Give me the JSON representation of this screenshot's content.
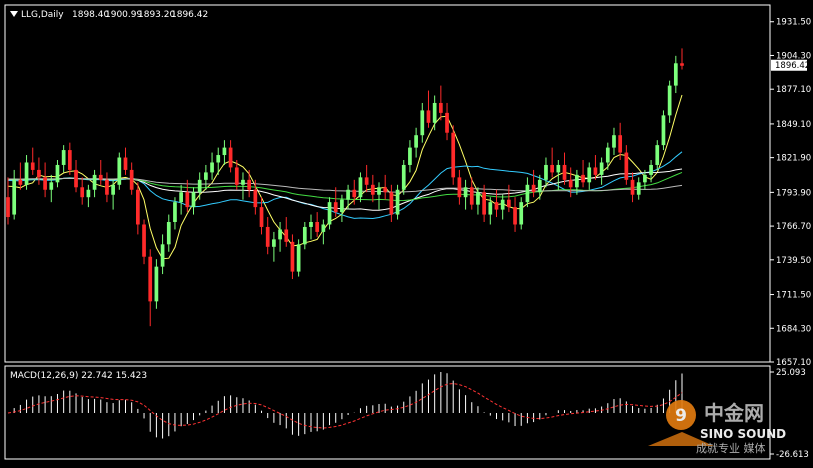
{
  "chart_data": [
    {
      "type": "candlestick",
      "symbol_label": "LLG,Daily",
      "ohlc_readout": [
        "1898.40",
        "1900.99",
        "1893.20",
        "1896.42"
      ],
      "ylim": [
        1657.1,
        1945
      ],
      "y_ticks": [
        "1931.50",
        "1904.30",
        "1877.10",
        "1849.10",
        "1821.90",
        "1793.90",
        "1766.70",
        "1739.50",
        "1711.50",
        "1684.30",
        "1657.10"
      ],
      "last_price": "1896.42",
      "colors": {
        "up": "#7CFF7C",
        "down": "#FF2A2A",
        "background": "#000000",
        "axis": "#FFFFFF"
      },
      "moving_averages": [
        {
          "color": "#FFFF66"
        },
        {
          "color": "#33CCFF"
        },
        {
          "color": "#FFFFFF"
        },
        {
          "color": "#44DD44"
        },
        {
          "color": "#BBBBBB"
        }
      ],
      "ohlc_estimated": [
        [
          1790,
          1806,
          1768,
          1774
        ],
        [
          1776,
          1812,
          1772,
          1804
        ],
        [
          1804,
          1818,
          1796,
          1800
        ],
        [
          1800,
          1824,
          1796,
          1818
        ],
        [
          1818,
          1830,
          1808,
          1812
        ],
        [
          1812,
          1822,
          1800,
          1806
        ],
        [
          1806,
          1818,
          1790,
          1796
        ],
        [
          1796,
          1808,
          1786,
          1802
        ],
        [
          1802,
          1820,
          1798,
          1816
        ],
        [
          1816,
          1832,
          1810,
          1828
        ],
        [
          1828,
          1834,
          1808,
          1812
        ],
        [
          1812,
          1820,
          1794,
          1798
        ],
        [
          1798,
          1806,
          1784,
          1790
        ],
        [
          1790,
          1800,
          1782,
          1796
        ],
        [
          1796,
          1812,
          1790,
          1808
        ],
        [
          1808,
          1820,
          1800,
          1804
        ],
        [
          1804,
          1810,
          1786,
          1792
        ],
        [
          1792,
          1804,
          1780,
          1800
        ],
        [
          1800,
          1826,
          1796,
          1822
        ],
        [
          1822,
          1830,
          1808,
          1812
        ],
        [
          1812,
          1818,
          1792,
          1796
        ],
        [
          1796,
          1802,
          1760,
          1768
        ],
        [
          1768,
          1772,
          1736,
          1742
        ],
        [
          1742,
          1748,
          1686,
          1706
        ],
        [
          1706,
          1740,
          1700,
          1734
        ],
        [
          1734,
          1760,
          1728,
          1752
        ],
        [
          1752,
          1776,
          1746,
          1770
        ],
        [
          1770,
          1790,
          1764,
          1786
        ],
        [
          1786,
          1800,
          1776,
          1794
        ],
        [
          1794,
          1804,
          1778,
          1782
        ],
        [
          1782,
          1798,
          1776,
          1794
        ],
        [
          1794,
          1810,
          1788,
          1804
        ],
        [
          1804,
          1816,
          1796,
          1810
        ],
        [
          1810,
          1826,
          1804,
          1818
        ],
        [
          1818,
          1830,
          1808,
          1824
        ],
        [
          1824,
          1836,
          1816,
          1830
        ],
        [
          1830,
          1836,
          1810,
          1814
        ],
        [
          1814,
          1820,
          1796,
          1800
        ],
        [
          1800,
          1810,
          1788,
          1804
        ],
        [
          1804,
          1812,
          1790,
          1796
        ],
        [
          1796,
          1804,
          1776,
          1782
        ],
        [
          1782,
          1790,
          1760,
          1766
        ],
        [
          1766,
          1774,
          1744,
          1750
        ],
        [
          1750,
          1762,
          1738,
          1756
        ],
        [
          1756,
          1770,
          1746,
          1764
        ],
        [
          1764,
          1774,
          1750,
          1754
        ],
        [
          1754,
          1760,
          1724,
          1730
        ],
        [
          1730,
          1756,
          1726,
          1752
        ],
        [
          1752,
          1770,
          1748,
          1766
        ],
        [
          1766,
          1776,
          1756,
          1770
        ],
        [
          1770,
          1778,
          1758,
          1762
        ],
        [
          1762,
          1772,
          1752,
          1768
        ],
        [
          1768,
          1790,
          1764,
          1786
        ],
        [
          1786,
          1798,
          1774,
          1778
        ],
        [
          1778,
          1792,
          1770,
          1788
        ],
        [
          1788,
          1800,
          1780,
          1796
        ],
        [
          1796,
          1804,
          1784,
          1790
        ],
        [
          1790,
          1810,
          1786,
          1806
        ],
        [
          1806,
          1816,
          1794,
          1800
        ],
        [
          1800,
          1808,
          1786,
          1792
        ],
        [
          1792,
          1802,
          1780,
          1798
        ],
        [
          1798,
          1808,
          1788,
          1794
        ],
        [
          1794,
          1800,
          1770,
          1776
        ],
        [
          1776,
          1800,
          1772,
          1796
        ],
        [
          1796,
          1820,
          1792,
          1816
        ],
        [
          1816,
          1836,
          1810,
          1830
        ],
        [
          1830,
          1846,
          1822,
          1840
        ],
        [
          1840,
          1866,
          1834,
          1860
        ],
        [
          1860,
          1876,
          1846,
          1850
        ],
        [
          1850,
          1872,
          1844,
          1866
        ],
        [
          1866,
          1880,
          1852,
          1858
        ],
        [
          1858,
          1866,
          1836,
          1842
        ],
        [
          1842,
          1848,
          1800,
          1806
        ],
        [
          1806,
          1812,
          1784,
          1790
        ],
        [
          1790,
          1804,
          1780,
          1798
        ],
        [
          1798,
          1806,
          1780,
          1784
        ],
        [
          1784,
          1798,
          1776,
          1794
        ],
        [
          1794,
          1800,
          1770,
          1776
        ],
        [
          1776,
          1790,
          1768,
          1786
        ],
        [
          1786,
          1796,
          1774,
          1780
        ],
        [
          1780,
          1792,
          1772,
          1788
        ],
        [
          1788,
          1800,
          1778,
          1782
        ],
        [
          1782,
          1790,
          1762,
          1768
        ],
        [
          1768,
          1790,
          1764,
          1786
        ],
        [
          1786,
          1806,
          1782,
          1800
        ],
        [
          1800,
          1812,
          1790,
          1794
        ],
        [
          1794,
          1808,
          1788,
          1804
        ],
        [
          1804,
          1822,
          1798,
          1816
        ],
        [
          1816,
          1830,
          1806,
          1810
        ],
        [
          1810,
          1820,
          1796,
          1816
        ],
        [
          1816,
          1826,
          1800,
          1804
        ],
        [
          1804,
          1814,
          1790,
          1798
        ],
        [
          1798,
          1812,
          1792,
          1808
        ],
        [
          1808,
          1820,
          1798,
          1802
        ],
        [
          1802,
          1818,
          1796,
          1814
        ],
        [
          1814,
          1824,
          1804,
          1808
        ],
        [
          1808,
          1822,
          1800,
          1818
        ],
        [
          1818,
          1834,
          1812,
          1830
        ],
        [
          1830,
          1846,
          1824,
          1840
        ],
        [
          1840,
          1850,
          1820,
          1826
        ],
        [
          1826,
          1832,
          1800,
          1804
        ],
        [
          1804,
          1810,
          1786,
          1792
        ],
        [
          1792,
          1806,
          1788,
          1802
        ],
        [
          1802,
          1812,
          1796,
          1808
        ],
        [
          1808,
          1820,
          1802,
          1816
        ],
        [
          1816,
          1836,
          1812,
          1832
        ],
        [
          1832,
          1860,
          1828,
          1856
        ],
        [
          1856,
          1884,
          1850,
          1880
        ],
        [
          1880,
          1904,
          1874,
          1898
        ],
        [
          1898,
          1910,
          1893,
          1896
        ]
      ]
    },
    {
      "type": "macd",
      "label": "MACD(12,26,9) 22.742 15.423",
      "y_ticks": [
        "25.093",
        "-26.613"
      ],
      "ylim": [
        -26.613,
        25.093
      ],
      "histogram_color": "#FFFFFF",
      "signal_color": "#FF3333"
    }
  ],
  "watermark": {
    "brand_cn": "中金网",
    "brand_en": "SINO SOUND",
    "slogan": "成就专业 媒体"
  }
}
